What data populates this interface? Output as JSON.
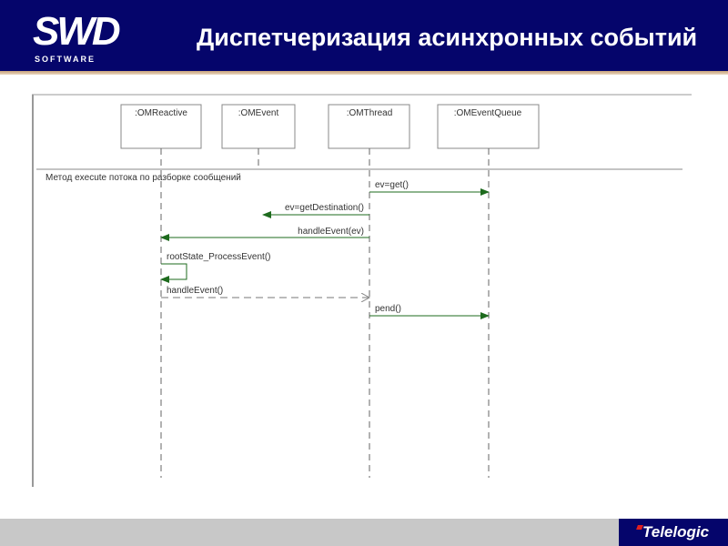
{
  "header": {
    "logo_text": "SWD",
    "logo_subtext": "SOFTWARE",
    "title": "Диспетчеризация асинхронных событий"
  },
  "diagram": {
    "lifelines": [
      ":OMReactive",
      ":OMEvent",
      ":OMThread",
      ":OMEventQueue"
    ],
    "note": "Метод execute потока по разборке сообщений",
    "messages": [
      {
        "label": "ev=get()",
        "from": ":OMThread",
        "to": ":OMEventQueue",
        "style": "solid"
      },
      {
        "label": "ev=getDestination()",
        "from": ":OMThread",
        "to": ":OMEvent",
        "style": "solid"
      },
      {
        "label": "handleEvent(ev)",
        "from": ":OMThread",
        "to": ":OMReactive",
        "style": "solid"
      },
      {
        "label": "rootState_ProcessEvent()",
        "from": ":OMReactive",
        "to": ":OMReactive",
        "style": "solid"
      },
      {
        "label": "handleEvent()",
        "from": ":OMReactive",
        "to": ":OMThread",
        "style": "dashed"
      },
      {
        "label": "pend()",
        "from": ":OMThread",
        "to": ":OMEventQueue",
        "style": "solid"
      }
    ],
    "arrow_color": "#1e6b1e"
  },
  "footer": {
    "brand": "Telelogic"
  }
}
